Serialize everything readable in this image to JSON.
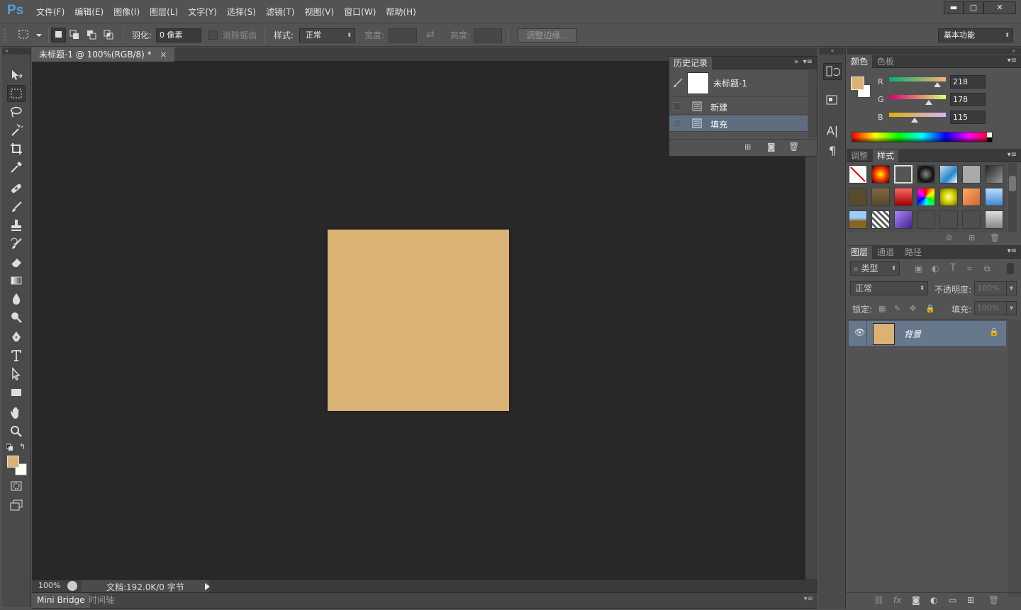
{
  "app": {
    "logo": "Ps",
    "menu": [
      "文件(F)",
      "编辑(E)",
      "图像(I)",
      "图层(L)",
      "文字(Y)",
      "选择(S)",
      "滤镜(T)",
      "视图(V)",
      "窗口(W)",
      "帮助(H)"
    ],
    "window_controls": [
      "minimize-icon",
      "maximize-icon",
      "close-icon"
    ]
  },
  "options_bar": {
    "feather_label": "羽化:",
    "feather_value": "0 像素",
    "antialias_label": "消除锯齿",
    "style_label": "样式:",
    "style_value": "正常",
    "width_label": "宽度:",
    "height_label": "高度:",
    "refine_edge_button": "调整边缘...",
    "workspace_value": "基本功能"
  },
  "document": {
    "tab_title": "未标题-1 @ 100%(RGB/8) *",
    "tab_close": "×",
    "zoom": "100%",
    "status": "文档:192.0K/0 字节",
    "canvas_color": "#dab273"
  },
  "bottom_tabs": [
    "Mini Bridge",
    "时间轴"
  ],
  "history_panel": {
    "tab": "历史记录",
    "snapshot_name": "未标题-1",
    "states": [
      "新建",
      "填充"
    ],
    "selected_state": 1
  },
  "color_panel": {
    "tabs": [
      "颜色",
      "色板"
    ],
    "channels": [
      {
        "label": "R",
        "value": "218",
        "fraction": 0.855
      },
      {
        "label": "G",
        "value": "178",
        "fraction": 0.698
      },
      {
        "label": "B",
        "value": "115",
        "fraction": 0.451
      }
    ],
    "foreground": "#dab273",
    "background": "#ffffff"
  },
  "styles_panel": {
    "tabs": [
      "调整",
      "样式"
    ],
    "active_tab": 1
  },
  "layers_panel": {
    "tabs": [
      "图层",
      "通道",
      "路径"
    ],
    "filter_label": "类型",
    "blend_mode": "正常",
    "opacity_label": "不透明度:",
    "opacity_value": "100%",
    "lock_label": "锁定:",
    "fill_label": "填充:",
    "fill_value": "100%",
    "layers": [
      {
        "name": "背景",
        "thumb": "#dab273",
        "locked": true,
        "visible": true
      }
    ]
  },
  "colors": {
    "accent": "#4fa0e0",
    "selection": "#68788c",
    "ui_bg": "#535353",
    "canvas_bg": "#282828"
  }
}
